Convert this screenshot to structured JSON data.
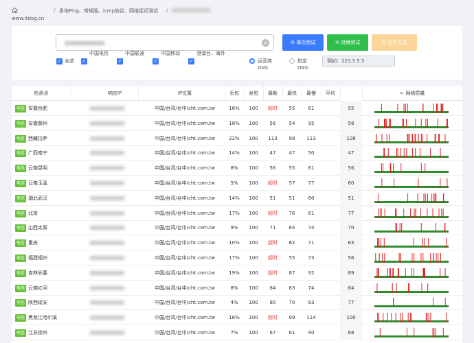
{
  "header": {
    "site": "www.itdog.cn",
    "separator": "/",
    "breadcrumb_current": "多地Ping、常规版、icmp协议、网络延迟测试"
  },
  "search": {
    "clear_icon": "×"
  },
  "buttons": {
    "single": "单次测试",
    "continuous": "持续测试",
    "generating": "正在生成"
  },
  "filters": [
    {
      "label": "全选",
      "checked": true
    },
    {
      "label": "中国电信",
      "checked": true
    },
    {
      "label": "中国联通",
      "checked": true
    },
    {
      "label": "中国移动",
      "checked": true
    },
    {
      "label": "港澳台、海外",
      "checked": true
    }
  ],
  "dns": {
    "option1": "运营商DNS",
    "option2": "指定DNS:",
    "placeholder": "例如：223.5.5.5"
  },
  "table": {
    "headers": [
      "检测点",
      "响应IP",
      "IP位置",
      "丢包",
      "发包",
      "最新",
      "最快",
      "最慢",
      "平均",
      "网络质量"
    ],
    "quality_icon": "∿",
    "rows": [
      {
        "isp": "电信",
        "node": "安徽合肥",
        "loc": "中国/台湾/台中/cht.com.tw",
        "loss": "16%",
        "sent": "100",
        "latest": "超时",
        "fast": "55",
        "slow": "61",
        "avg": "55"
      },
      {
        "isp": "电信",
        "node": "安徽滁州",
        "loc": "中国/台湾/台中/cht.com.tw",
        "loss": "18%",
        "sent": "100",
        "latest": "56",
        "fast": "54",
        "slow": "95",
        "avg": "58"
      },
      {
        "isp": "电信",
        "node": "西藏拉萨",
        "loc": "中国/台湾/台中/cht.com.tw",
        "loss": "22%",
        "sent": "100",
        "latest": "113",
        "fast": "98",
        "slow": "113",
        "avg": "108"
      },
      {
        "isp": "电信",
        "node": "广西南宁",
        "loc": "中国/台湾/台中/cht.com.tw",
        "loss": "14%",
        "sent": "100",
        "latest": "47",
        "fast": "47",
        "slow": "50",
        "avg": "47"
      },
      {
        "isp": "电信",
        "node": "云南昆明",
        "loc": "中国/台湾/台中/cht.com.tw",
        "loss": "8%",
        "sent": "100",
        "latest": "56",
        "fast": "55",
        "slow": "61",
        "avg": "56"
      },
      {
        "isp": "电信",
        "node": "云南玉溪",
        "loc": "中国/台湾/台中/cht.com.tw",
        "loss": "5%",
        "sent": "100",
        "latest": "超时",
        "fast": "57",
        "slow": "77",
        "avg": "60"
      },
      {
        "isp": "电信",
        "node": "湖北武汉",
        "loc": "中国/台湾/台中/cht.com.tw",
        "loss": "14%",
        "sent": "100",
        "latest": "51",
        "fast": "51",
        "slow": "60",
        "avg": "51"
      },
      {
        "isp": "电信",
        "node": "北京",
        "loc": "中国/台湾/台中/cht.com.tw",
        "loss": "17%",
        "sent": "100",
        "latest": "超时",
        "fast": "76",
        "slow": "81",
        "avg": "77"
      },
      {
        "isp": "电信",
        "node": "山西太原",
        "loc": "中国/台湾/台中/cht.com.tw",
        "loss": "9%",
        "sent": "100",
        "latest": "71",
        "fast": "64",
        "slow": "74",
        "avg": "70"
      },
      {
        "isp": "电信",
        "node": "重庆",
        "loc": "中国/台湾/台中/cht.com.tw",
        "loss": "10%",
        "sent": "100",
        "latest": "超时",
        "fast": "62",
        "slow": "71",
        "avg": "63"
      },
      {
        "isp": "电信",
        "node": "福建福州",
        "loc": "中国/台湾/台中/cht.com.tw",
        "loss": "17%",
        "sent": "100",
        "latest": "超时",
        "fast": "55",
        "slow": "73",
        "avg": "56"
      },
      {
        "isp": "电信",
        "node": "吉林长春",
        "loc": "中国/台湾/台中/cht.com.tw",
        "loss": "19%",
        "sent": "100",
        "latest": "超时",
        "fast": "87",
        "slow": "92",
        "avg": "89"
      },
      {
        "isp": "电信",
        "node": "云南红河",
        "loc": "中国/台湾/台中/cht.com.tw",
        "loss": "8%",
        "sent": "100",
        "latest": "64",
        "fast": "63",
        "slow": "74",
        "avg": "64"
      },
      {
        "isp": "电信",
        "node": "陕西延安",
        "loc": "中国/台湾/台中/cht.com.tw",
        "loss": "4%",
        "sent": "100",
        "latest": "80",
        "fast": "70",
        "slow": "83",
        "avg": "77"
      },
      {
        "isp": "电信",
        "node": "黑龙江哈尔滨",
        "loc": "中国/台湾/台中/cht.com.tw",
        "loss": "16%",
        "sent": "100",
        "latest": "超时",
        "fast": "99",
        "slow": "114",
        "avg": "100"
      },
      {
        "isp": "电信",
        "node": "江苏徐州",
        "loc": "中国/台湾/台中/cht.com.tw",
        "loss": "7%",
        "sent": "100",
        "latest": "67",
        "fast": "61",
        "slow": "90",
        "avg": "68"
      }
    ]
  },
  "colors": {
    "primary": "#3b7cff",
    "success": "#2fbe4a",
    "warning_light": "#fbd59a",
    "isp_badge": "#67c23a",
    "timeout": "#e53935",
    "spark_ok": "#2e8b2e",
    "spark_loss": "#e02020"
  }
}
